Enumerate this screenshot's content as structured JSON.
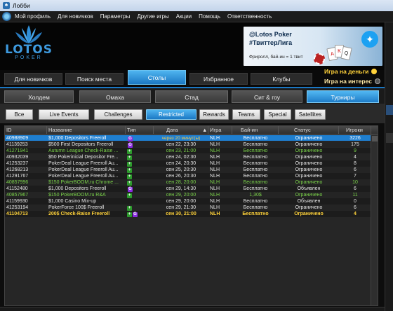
{
  "window": {
    "title": "Лобби"
  },
  "menu": [
    "Мой профиль",
    "Для новичков",
    "Параметры",
    "Другие игры",
    "Акции",
    "Помощь",
    "Ответственность"
  ],
  "logo": {
    "brand": "LOTOS",
    "sub": "POKER"
  },
  "banner": {
    "handle": "@Lotos Poker",
    "hashtag": "#ТвиттерЛига",
    "freeroll": "Фриролл, бай-ин = 1 твит"
  },
  "main_tabs": [
    "Для новичков",
    "Поиск места",
    "Столы",
    "Избранное",
    "Клубы"
  ],
  "money": {
    "real": "Игра на деньги",
    "play": "Игра на интерес",
    "real_color": "#ffd23a",
    "play_color": "#ffe9a6"
  },
  "game_types": [
    "Холдем",
    "Омаха",
    "Стад",
    "Сит & гоу",
    "Турниры"
  ],
  "filters": [
    "Все",
    "Live Events",
    "Challenges",
    "Restricted",
    "Rewards",
    "Teams",
    "Special",
    "Satellites"
  ],
  "columns": [
    "ID",
    "Название",
    "Тип",
    "Дата",
    "Игра",
    "Бай-ин",
    "Статус",
    "Игроки"
  ],
  "rows": [
    {
      "id": "40988909",
      "name": "$1,000 Depositors Freeroll",
      "type": "G",
      "date": "через 20 минут(ы)",
      "game": "NLH",
      "buyin": "Бесплатно",
      "status": "Ограничено",
      "players": "3226",
      "style": "selected"
    },
    {
      "id": "41139253",
      "name": "$500 First Depositors Freeroll",
      "type": "G",
      "date": "сен 22, 23:30",
      "game": "NLH",
      "buyin": "Бесплатно",
      "status": "Ограничено",
      "players": "175",
      "style": "normal"
    },
    {
      "id": "41271941",
      "name": "Autumn League Check-Raise ...",
      "type": "+",
      "date": "сен 23, 21:00",
      "game": "NLH",
      "buyin": "Бесплатно",
      "status": "Ограничено",
      "players": "9",
      "style": "green"
    },
    {
      "id": "40932039",
      "name": "$50 Pokerinicial Depositor Fre...",
      "type": "+",
      "date": "сен 24, 02:30",
      "game": "NLH",
      "buyin": "Бесплатно",
      "status": "Ограничено",
      "players": "4",
      "style": "normal"
    },
    {
      "id": "41253237",
      "name": "PokerDeal League Freeroll Au...",
      "type": "+",
      "date": "сен 24, 20:30",
      "game": "NLH",
      "buyin": "Бесплатно",
      "status": "Ограничено",
      "players": "8",
      "style": "normal"
    },
    {
      "id": "41268213",
      "name": "PokerDeal League Freeroll Au...",
      "type": "+",
      "date": "сен 25, 20:30",
      "game": "NLH",
      "buyin": "Бесплатно",
      "status": "Ограничено",
      "players": "6",
      "style": "normal"
    },
    {
      "id": "41291767",
      "name": "PokerDeal League Freeroll Au...",
      "type": "+",
      "date": "сен 26, 20:30",
      "game": "NLH",
      "buyin": "Бесплатно",
      "status": "Ограничено",
      "players": "7",
      "style": "normal"
    },
    {
      "id": "40857996",
      "name": "$150 PokerBOOM.ru Chrome ...",
      "type": "+",
      "date": "сен 28, 20:00",
      "game": "NLH",
      "buyin": "Бесплатно",
      "status": "Ограничено",
      "players": "10",
      "style": "green"
    },
    {
      "id": "41152480",
      "name": "$1,000 Depositors Freeroll",
      "type": "G",
      "date": "сен 29, 14:30",
      "game": "NLH",
      "buyin": "Бесплатно",
      "status": "Объявлен",
      "players": "6",
      "style": "normal"
    },
    {
      "id": "40857967",
      "name": "$150 PokerBOOM.ru R&A",
      "type": "+",
      "date": "сен 29, 20:00",
      "game": "NLH",
      "buyin": "1,30$",
      "status": "Ограничено",
      "players": "11",
      "style": "green"
    },
    {
      "id": "41159930",
      "name": "$1,000 Casino Mix-up",
      "type": "",
      "date": "сен 29, 20:00",
      "game": "NLH",
      "buyin": "Бесплатно",
      "status": "Объявлен",
      "players": "0",
      "style": "normal"
    },
    {
      "id": "41253194",
      "name": "PokerForce 100$ Freeroll",
      "type": "+",
      "date": "сен 29, 21:30",
      "game": "NLH",
      "buyin": "Бесплатно",
      "status": "Ограничено",
      "players": "6",
      "style": "normal"
    },
    {
      "id": "41104713",
      "name": "200$ Check-Raise Freeroll",
      "type": "+G",
      "date": "сен 30, 21:00",
      "game": "NLH",
      "buyin": "Бесплатно",
      "status": "Ограничено",
      "players": "4",
      "style": "yellow"
    }
  ],
  "colors": {
    "accent": "#1b78c4",
    "selected_row": "#1f7fd0",
    "green_text": "#7bd34a",
    "yellow_text": "#ffd23a"
  }
}
